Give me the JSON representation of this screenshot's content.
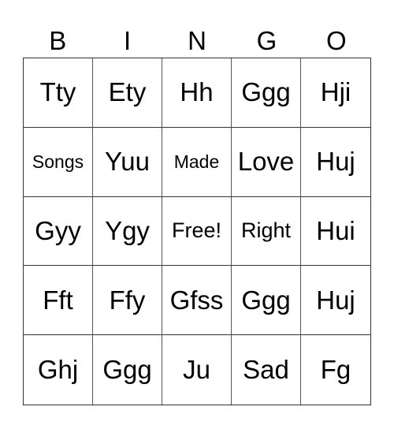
{
  "card": {
    "header": [
      "B",
      "I",
      "N",
      "G",
      "O"
    ],
    "rows": [
      [
        "Tty",
        "Ety",
        "Hh",
        "Ggg",
        "Hji"
      ],
      [
        "Songs",
        "Yuu",
        "Made",
        "Love",
        "Huj"
      ],
      [
        "Gyy",
        "Ygy",
        "Free!",
        "Right",
        "Hui"
      ],
      [
        "Fft",
        "Ffy",
        "Gfss",
        "Ggg",
        "Huj"
      ],
      [
        "Ghj",
        "Ggg",
        "Ju",
        "Sad",
        "Fg"
      ]
    ]
  }
}
